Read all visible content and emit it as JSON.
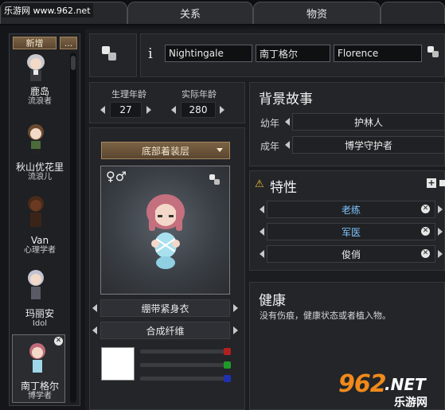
{
  "watermark_top": "乐游网 www.962.net",
  "tabs": [
    "",
    "关系",
    "物资",
    ""
  ],
  "sidebar": {
    "add_label": "新增",
    "more_label": "...",
    "colonists": [
      {
        "name": "鹿岛",
        "sub": "流浪者"
      },
      {
        "name": "秋山优花里",
        "sub": "流浪儿"
      },
      {
        "name": "Van",
        "sub": "心理学者"
      },
      {
        "name": "玛丽安",
        "sub": "Idol"
      },
      {
        "name": "南丁格尔",
        "sub": "博学者"
      }
    ]
  },
  "name_fields": {
    "first": "Nightingale",
    "middle": "南丁格尔",
    "last": "Florence"
  },
  "age": {
    "bio_label": "生理年龄",
    "bio_value": "27",
    "chrono_label": "实际年龄",
    "chrono_value": "280"
  },
  "apparel": {
    "layer_dropdown": "底部着装层",
    "item": "绷带紧身衣",
    "material": "合成纤维"
  },
  "gender_symbols": "♀♂",
  "backstory": {
    "title": "背景故事",
    "child_label": "幼年",
    "child_value": "护林人",
    "adult_label": "成年",
    "adult_value": "博学守护者"
  },
  "traits": {
    "title": "特性",
    "items": [
      {
        "label": "老练",
        "color": "#7fc4ff"
      },
      {
        "label": "军医",
        "color": "#7fc4ff"
      },
      {
        "label": "俊俏",
        "color": "#e9e9e9"
      }
    ]
  },
  "health": {
    "title": "健康",
    "text": "没有伤痕，健康状态或者植入物。"
  },
  "color_knobs": [
    "#b02020",
    "#1f9a2a",
    "#2030b0"
  ],
  "watermark_bottom": {
    "big": "962",
    "dot": ".NET",
    "small": "乐游网"
  }
}
